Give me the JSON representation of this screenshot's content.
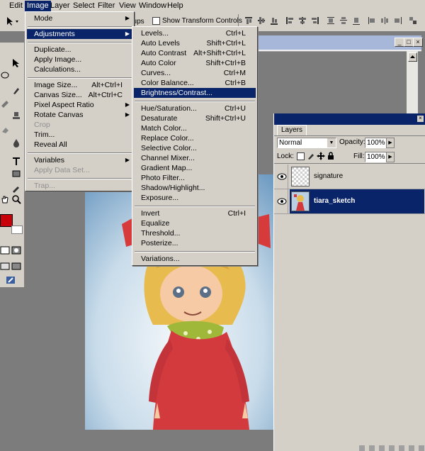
{
  "menubar": {
    "items": [
      "Edit",
      "Image",
      "Layer",
      "Select",
      "Filter",
      "View",
      "Window",
      "Help"
    ],
    "active": "Image"
  },
  "options_bar": {
    "groups_label": "oups",
    "show_transform_label": "Show Transform Controls"
  },
  "image_menu": {
    "items": [
      {
        "label": "Mode",
        "shortcut": "",
        "submenu": true
      },
      {
        "label": "Adjustments",
        "shortcut": "",
        "submenu": true,
        "highlighted": true
      },
      {
        "label": "Duplicate...",
        "shortcut": ""
      },
      {
        "label": "Apply Image...",
        "shortcut": ""
      },
      {
        "label": "Calculations...",
        "shortcut": ""
      },
      {
        "label": "Image Size...",
        "shortcut": "Alt+Ctrl+I"
      },
      {
        "label": "Canvas Size...",
        "shortcut": "Alt+Ctrl+C"
      },
      {
        "label": "Pixel Aspect Ratio",
        "shortcut": "",
        "submenu": true
      },
      {
        "label": "Rotate Canvas",
        "shortcut": "",
        "submenu": true
      },
      {
        "label": "Crop",
        "shortcut": "",
        "disabled": true
      },
      {
        "label": "Trim...",
        "shortcut": ""
      },
      {
        "label": "Reveal All",
        "shortcut": ""
      },
      {
        "label": "Variables",
        "shortcut": "",
        "submenu": true
      },
      {
        "label": "Apply Data Set...",
        "shortcut": "",
        "disabled": true
      },
      {
        "label": "Trap...",
        "shortcut": "",
        "disabled": true
      }
    ]
  },
  "adjustments_menu": {
    "items": [
      {
        "label": "Levels...",
        "shortcut": "Ctrl+L"
      },
      {
        "label": "Auto Levels",
        "shortcut": "Shift+Ctrl+L"
      },
      {
        "label": "Auto Contrast",
        "shortcut": "Alt+Shift+Ctrl+L"
      },
      {
        "label": "Auto Color",
        "shortcut": "Shift+Ctrl+B"
      },
      {
        "label": "Curves...",
        "shortcut": "Ctrl+M"
      },
      {
        "label": "Color Balance...",
        "shortcut": "Ctrl+B"
      },
      {
        "label": "Brightness/Contrast...",
        "shortcut": "",
        "highlighted": true
      },
      {
        "label": "Hue/Saturation...",
        "shortcut": "Ctrl+U"
      },
      {
        "label": "Desaturate",
        "shortcut": "Shift+Ctrl+U"
      },
      {
        "label": "Match Color...",
        "shortcut": ""
      },
      {
        "label": "Replace Color...",
        "shortcut": ""
      },
      {
        "label": "Selective Color...",
        "shortcut": ""
      },
      {
        "label": "Channel Mixer...",
        "shortcut": ""
      },
      {
        "label": "Gradient Map...",
        "shortcut": ""
      },
      {
        "label": "Photo Filter...",
        "shortcut": ""
      },
      {
        "label": "Shadow/Highlight...",
        "shortcut": ""
      },
      {
        "label": "Exposure...",
        "shortcut": ""
      },
      {
        "label": "Invert",
        "shortcut": "Ctrl+I"
      },
      {
        "label": "Equalize",
        "shortcut": ""
      },
      {
        "label": "Threshold...",
        "shortcut": ""
      },
      {
        "label": "Posterize...",
        "shortcut": ""
      },
      {
        "label": "Variations...",
        "shortcut": ""
      }
    ]
  },
  "layers_panel": {
    "tab_label": "Layers",
    "blend_mode": "Normal",
    "opacity_label": "Opacity:",
    "opacity_value": "100%",
    "lock_label": "Lock:",
    "fill_label": "Fill:",
    "fill_value": "100%",
    "layers": [
      {
        "name": "signature",
        "selected": false
      },
      {
        "name": "tiara_sketch",
        "selected": true
      }
    ]
  },
  "colors": {
    "menu_highlight": "#0a246a",
    "foreground_swatch": "#c8000a",
    "chrome": "#d4d0c8"
  },
  "icons": [
    "move-tool-icon",
    "eye-icon",
    "arrow-right-icon",
    "dropdown-arrow-icon",
    "lock-icon",
    "brush-icon",
    "lasso-icon",
    "text-tool-icon",
    "hand-tool-icon",
    "zoom-tool-icon"
  ]
}
